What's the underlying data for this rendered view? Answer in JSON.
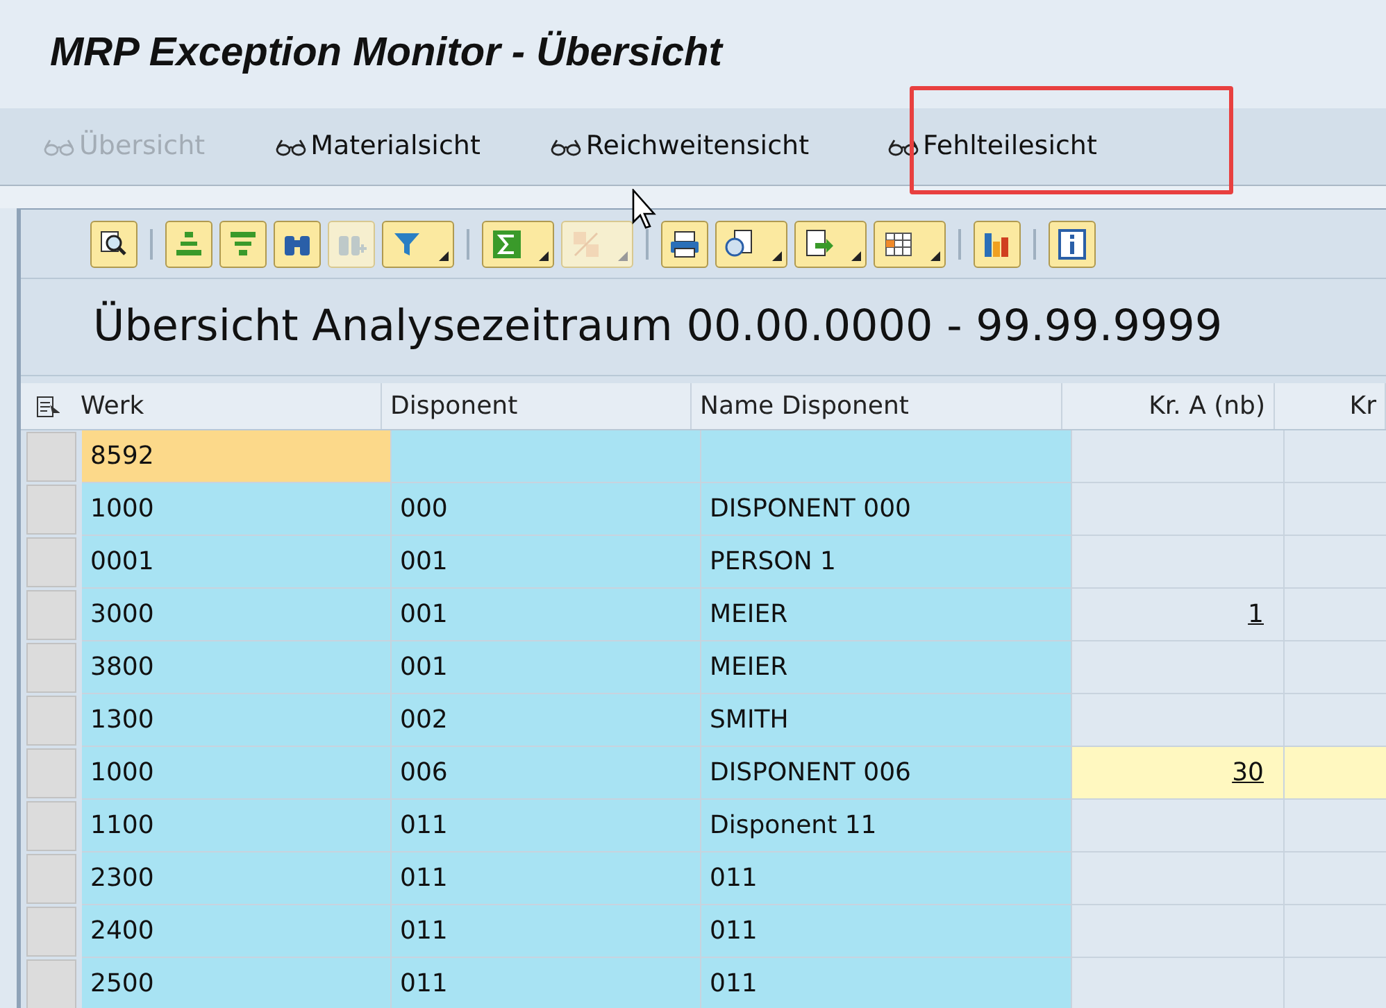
{
  "window": {
    "title": "MRP Exception Monitor - Übersicht"
  },
  "view_buttons": [
    {
      "label": "Übersicht",
      "disabled": true
    },
    {
      "label": "Materialsicht",
      "disabled": false
    },
    {
      "label": "Reichweitensicht",
      "disabled": false
    },
    {
      "label": "Fehlteilesicht",
      "disabled": false,
      "highlighted": true
    }
  ],
  "toolbar_groups": [
    [
      {
        "dropdown": false,
        "disabled": false
      }
    ],
    [
      {
        "dropdown": false,
        "disabled": false
      },
      {
        "dropdown": false,
        "disabled": false
      },
      {
        "dropdown": false,
        "disabled": false
      },
      {
        "dropdown": false,
        "disabled": true
      },
      {
        "dropdown": true,
        "disabled": false
      }
    ],
    [
      {
        "dropdown": true,
        "disabled": false
      },
      {
        "dropdown": true,
        "disabled": true
      }
    ],
    [
      {
        "dropdown": false,
        "disabled": false
      },
      {
        "dropdown": true,
        "disabled": false
      },
      {
        "dropdown": true,
        "disabled": false
      },
      {
        "dropdown": true,
        "disabled": false
      }
    ],
    [
      {
        "dropdown": false,
        "disabled": false
      }
    ],
    [
      {
        "dropdown": false,
        "disabled": false
      }
    ]
  ],
  "table": {
    "title": "Übersicht Analysezeitraum 00.00.0000 - 99.99.9999",
    "columns": [
      "Werk",
      "Disponent",
      "Name Disponent",
      "Kr. A (nb)",
      "Kr"
    ],
    "rows": [
      {
        "werk": "8592",
        "disponent": "",
        "name": "",
        "kr_a": "",
        "werk_selected": true,
        "critical": false
      },
      {
        "werk": "1000",
        "disponent": "000",
        "name": "DISPONENT 000",
        "kr_a": "",
        "werk_selected": false,
        "critical": false
      },
      {
        "werk": "0001",
        "disponent": "001",
        "name": "PERSON 1",
        "kr_a": "",
        "werk_selected": false,
        "critical": false
      },
      {
        "werk": "3000",
        "disponent": "001",
        "name": "MEIER",
        "kr_a": "1",
        "werk_selected": false,
        "critical": false
      },
      {
        "werk": "3800",
        "disponent": "001",
        "name": "MEIER",
        "kr_a": "",
        "werk_selected": false,
        "critical": false
      },
      {
        "werk": "1300",
        "disponent": "002",
        "name": "SMITH",
        "kr_a": "",
        "werk_selected": false,
        "critical": false
      },
      {
        "werk": "1000",
        "disponent": "006",
        "name": "DISPONENT 006",
        "kr_a": "30",
        "werk_selected": false,
        "critical": true
      },
      {
        "werk": "1100",
        "disponent": "011",
        "name": "Disponent 11",
        "kr_a": "",
        "werk_selected": false,
        "critical": false
      },
      {
        "werk": "2300",
        "disponent": "011",
        "name": "011",
        "kr_a": "",
        "werk_selected": false,
        "critical": false
      },
      {
        "werk": "2400",
        "disponent": "011",
        "name": "011",
        "kr_a": "",
        "werk_selected": false,
        "critical": false
      },
      {
        "werk": "2500",
        "disponent": "011",
        "name": "011",
        "kr_a": "",
        "werk_selected": false,
        "critical": false
      }
    ]
  }
}
